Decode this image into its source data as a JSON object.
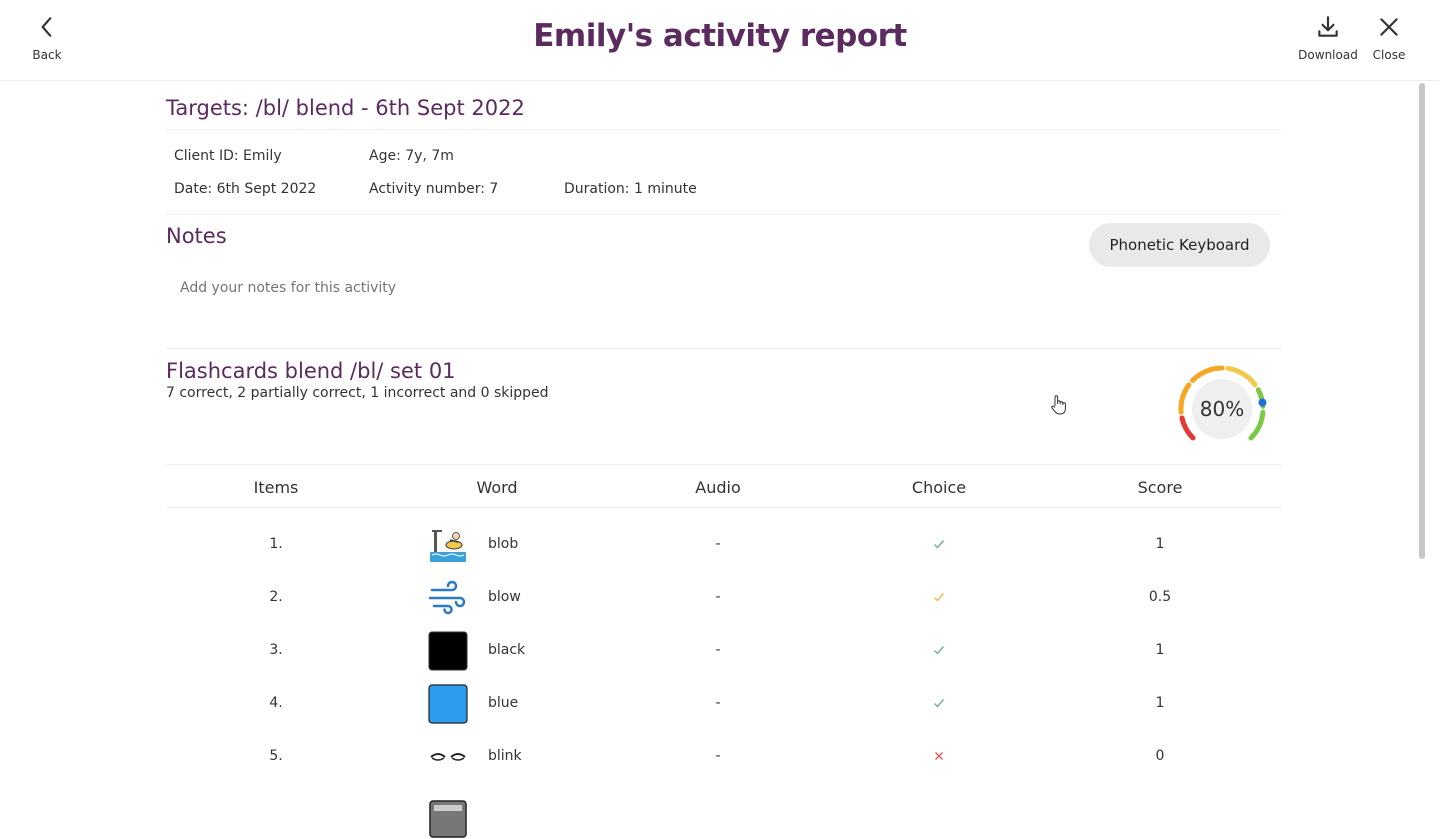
{
  "header": {
    "title": "Emily's activity report",
    "back_label": "Back",
    "download_label": "Download",
    "close_label": "Close"
  },
  "report": {
    "targets_title": "Targets: /bl/ blend - 6th Sept 2022",
    "client_id": "Client ID: Emily",
    "age": "Age: 7y, 7m",
    "date": "Date: 6th Sept 2022",
    "activity_number": "Activity number: 7",
    "duration": "Duration: 1 minute"
  },
  "notes": {
    "title": "Notes",
    "phonetic_keyboard_label": "Phonetic Keyboard",
    "placeholder": "Add your notes for this activity"
  },
  "flashcards": {
    "title": "Flashcards blend /bl/ set 01",
    "summary": "7 correct, 2 partially correct, 1 incorrect and 0 skipped",
    "score_percent": 80,
    "score_label": "80%"
  },
  "table": {
    "headers": [
      "Items",
      "Word",
      "Audio",
      "Choice",
      "Score"
    ],
    "rows": [
      {
        "item": "1.",
        "word": "blob",
        "image": "blob-picture",
        "audio": "-",
        "choice": "correct",
        "score": "1"
      },
      {
        "item": "2.",
        "word": "blow",
        "image": "wind-picture",
        "audio": "-",
        "choice": "partial",
        "score": "0.5"
      },
      {
        "item": "3.",
        "word": "black",
        "image": "black-square",
        "audio": "-",
        "choice": "correct",
        "score": "1"
      },
      {
        "item": "4.",
        "word": "blue",
        "image": "blue-square",
        "audio": "-",
        "choice": "correct",
        "score": "1"
      },
      {
        "item": "5.",
        "word": "blink",
        "image": "eyes-picture",
        "audio": "-",
        "choice": "incorrect",
        "score": "0"
      }
    ]
  },
  "colors": {
    "title": "#5b2a5e",
    "correct": "#7aa6a0",
    "partial": "#f2b84b",
    "incorrect": "#e05656",
    "gauge_red": "#e53935",
    "gauge_orange": "#f5a623",
    "gauge_yellow": "#f2c94c",
    "gauge_green": "#7ac943",
    "gauge_marker": "#1e6fd9"
  }
}
